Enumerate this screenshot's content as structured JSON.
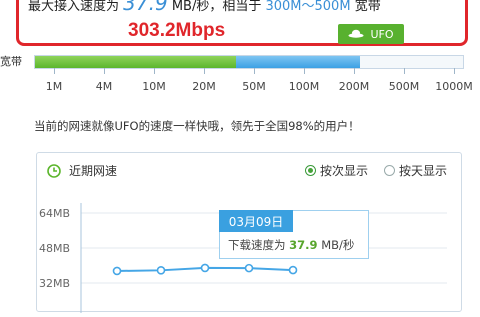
{
  "result": {
    "prefix": "最大接入速度为",
    "speed": "37.9",
    "unit": "MB/秒，相当于",
    "range": "300M～500M",
    "suffix": "宽带",
    "mbps": "303.2Mbps",
    "badge_label": "UFO"
  },
  "bandwidth": {
    "label": "宽带",
    "ticks": [
      "1M",
      "4M",
      "10M",
      "20M",
      "50M",
      "100M",
      "200M",
      "500M",
      "1000M"
    ],
    "green_fraction": 0.47,
    "blue_fraction": 0.29
  },
  "compare_text": "当前的网速就像UFO的速度一样快哦，领先于全国98%的用户！",
  "history": {
    "title": "近期网速",
    "options": [
      {
        "label": "按次显示",
        "selected": true
      },
      {
        "label": "按天显示",
        "selected": false
      }
    ],
    "tooltip": {
      "date": "03月09日",
      "prefix": "下载速度为",
      "value": "37.9",
      "unit": "MB/秒"
    }
  },
  "chart_data": {
    "type": "line",
    "title": "近期网速",
    "xlabel": "",
    "ylabel": "",
    "y_ticks": [
      "64MB",
      "48MB",
      "32MB"
    ],
    "ylim": [
      32,
      64
    ],
    "series": [
      {
        "values": [
          37.5,
          37.8,
          38.9,
          38.8,
          37.9
        ]
      }
    ],
    "grid": true,
    "colors": {
      "line": "#45a6e6",
      "grid": "#e3e9ef"
    }
  }
}
